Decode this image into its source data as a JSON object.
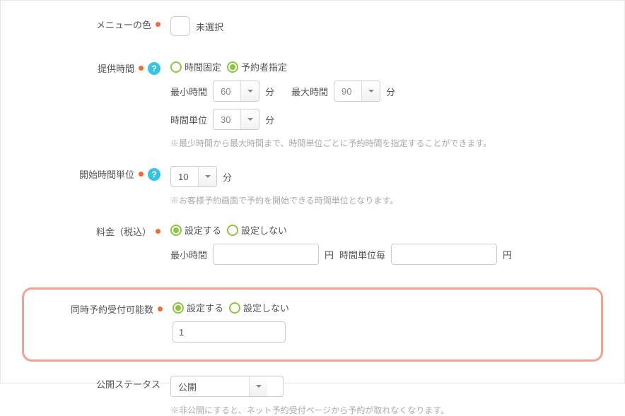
{
  "menuColor": {
    "label": "メニューの色",
    "valueText": "未選択"
  },
  "serviceTime": {
    "label": "提供時間",
    "radioFixed": "時間固定",
    "radioCustomer": "予約者指定",
    "minLabel": "最小時間",
    "minValue": "60",
    "minUnit": "分",
    "maxLabel": "最大時間",
    "maxValue": "90",
    "maxUnit": "分",
    "unitLabel": "時間単位",
    "unitValue": "30",
    "unitUnit": "分",
    "hint": "※最少時間から最大時間まで、時間単位ごとに予約時間を指定することができます。"
  },
  "startUnit": {
    "label": "開始時間単位",
    "value": "10",
    "unit": "分",
    "hint": "※お客様予約画面で予約を開始できる時間単位となります。"
  },
  "price": {
    "label": "料金（税込）",
    "radioSet": "設定する",
    "radioUnset": "設定しない",
    "minLabel": "最小時間",
    "currency": "円",
    "perUnitLabel": "時間単位毎",
    "currency2": "円"
  },
  "concurrent": {
    "label": "同時予約受付可能数",
    "radioSet": "設定する",
    "radioUnset": "設定しない",
    "value": "1"
  },
  "publishStatus": {
    "label": "公開ステータス",
    "value": "公開",
    "hint": "※非公開にすると、ネット予約受付ページから予約が取れなくなります。"
  }
}
